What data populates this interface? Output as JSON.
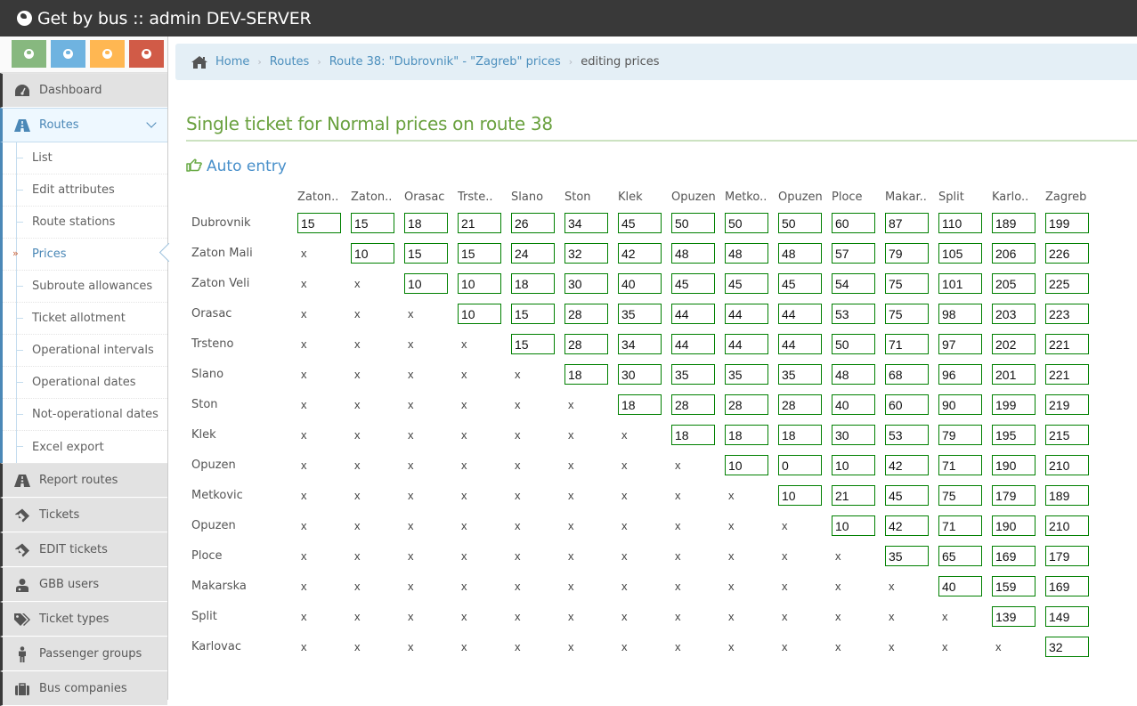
{
  "navbar": {
    "title": "Get by bus :: admin DEV-SERVER"
  },
  "sidebar": {
    "shortcuts": [
      {
        "color": "#87b87f",
        "icon": "globe-icon"
      },
      {
        "color": "#6fb3e0",
        "icon": "globe-icon"
      },
      {
        "color": "#ffb752",
        "icon": "globe-icon"
      },
      {
        "color": "#d15b47",
        "icon": "globe-icon"
      }
    ],
    "items": [
      {
        "label": "Dashboard",
        "icon": "dashboard-icon"
      },
      {
        "label": "Routes",
        "icon": "road-icon",
        "open": true,
        "subitems": [
          {
            "label": "List"
          },
          {
            "label": "Edit attributes"
          },
          {
            "label": "Route stations"
          },
          {
            "label": "Prices",
            "active": true
          },
          {
            "label": "Subroute allowances"
          },
          {
            "label": "Ticket allotment"
          },
          {
            "label": "Operational intervals"
          },
          {
            "label": "Operational dates"
          },
          {
            "label": "Not-operational dates"
          },
          {
            "label": "Excel export"
          }
        ]
      },
      {
        "label": "Report routes",
        "icon": "road-icon"
      },
      {
        "label": "Tickets",
        "icon": "ticket-icon"
      },
      {
        "label": "EDIT tickets",
        "icon": "ticket-icon"
      },
      {
        "label": "GBB users",
        "icon": "user-md-icon"
      },
      {
        "label": "Ticket types",
        "icon": "tags-icon"
      },
      {
        "label": "Passenger groups",
        "icon": "male-icon"
      },
      {
        "label": "Bus companies",
        "icon": "briefcase-icon"
      }
    ]
  },
  "breadcrumbs": {
    "home": "Home",
    "routes": "Routes",
    "route": "Route 38: \"Dubrovnik\" - \"Zagreb\" prices",
    "current": "editing prices"
  },
  "page": {
    "title": "Single ticket for Normal prices on route 38",
    "auto_entry": "Auto entry"
  },
  "colors": {
    "title_green": "#6aa13f",
    "link_blue": "#4c8fbd",
    "input_border": "#008000"
  },
  "table": {
    "columns": [
      "Zaton..",
      "Zaton..",
      "Orasac",
      "Trste..",
      "Slano",
      "Ston",
      "Klek",
      "Opuzen",
      "Metko..",
      "Opuzen",
      "Ploce",
      "Makar..",
      "Split",
      "Karlo..",
      "Zagreb"
    ],
    "rows": [
      {
        "label": "Dubrovnik",
        "values": [
          "15",
          "15",
          "18",
          "21",
          "26",
          "34",
          "45",
          "50",
          "50",
          "50",
          "60",
          "87",
          "110",
          "189",
          "199"
        ]
      },
      {
        "label": "Zaton Mali",
        "values": [
          "x",
          "10",
          "15",
          "15",
          "24",
          "32",
          "42",
          "48",
          "48",
          "48",
          "57",
          "79",
          "105",
          "206",
          "226"
        ]
      },
      {
        "label": "Zaton Veli",
        "values": [
          "x",
          "x",
          "10",
          "10",
          "18",
          "30",
          "40",
          "45",
          "45",
          "45",
          "54",
          "75",
          "101",
          "205",
          "225"
        ]
      },
      {
        "label": "Orasac",
        "values": [
          "x",
          "x",
          "x",
          "10",
          "15",
          "28",
          "35",
          "44",
          "44",
          "44",
          "53",
          "75",
          "98",
          "203",
          "223"
        ]
      },
      {
        "label": "Trsteno",
        "values": [
          "x",
          "x",
          "x",
          "x",
          "15",
          "28",
          "34",
          "44",
          "44",
          "44",
          "50",
          "71",
          "97",
          "202",
          "221"
        ]
      },
      {
        "label": "Slano",
        "values": [
          "x",
          "x",
          "x",
          "x",
          "x",
          "18",
          "30",
          "35",
          "35",
          "35",
          "48",
          "68",
          "96",
          "201",
          "221"
        ]
      },
      {
        "label": "Ston",
        "values": [
          "x",
          "x",
          "x",
          "x",
          "x",
          "x",
          "18",
          "28",
          "28",
          "28",
          "40",
          "60",
          "90",
          "199",
          "219"
        ]
      },
      {
        "label": "Klek",
        "values": [
          "x",
          "x",
          "x",
          "x",
          "x",
          "x",
          "x",
          "18",
          "18",
          "18",
          "30",
          "53",
          "79",
          "195",
          "215"
        ]
      },
      {
        "label": "Opuzen",
        "values": [
          "x",
          "x",
          "x",
          "x",
          "x",
          "x",
          "x",
          "x",
          "10",
          "0",
          "10",
          "42",
          "71",
          "190",
          "210"
        ]
      },
      {
        "label": "Metkovic",
        "values": [
          "x",
          "x",
          "x",
          "x",
          "x",
          "x",
          "x",
          "x",
          "x",
          "10",
          "21",
          "45",
          "75",
          "179",
          "189"
        ]
      },
      {
        "label": "Opuzen",
        "values": [
          "x",
          "x",
          "x",
          "x",
          "x",
          "x",
          "x",
          "x",
          "x",
          "x",
          "10",
          "42",
          "71",
          "190",
          "210"
        ]
      },
      {
        "label": "Ploce",
        "values": [
          "x",
          "x",
          "x",
          "x",
          "x",
          "x",
          "x",
          "x",
          "x",
          "x",
          "x",
          "35",
          "65",
          "169",
          "179"
        ]
      },
      {
        "label": "Makarska",
        "values": [
          "x",
          "x",
          "x",
          "x",
          "x",
          "x",
          "x",
          "x",
          "x",
          "x",
          "x",
          "x",
          "40",
          "159",
          "169"
        ]
      },
      {
        "label": "Split",
        "values": [
          "x",
          "x",
          "x",
          "x",
          "x",
          "x",
          "x",
          "x",
          "x",
          "x",
          "x",
          "x",
          "x",
          "139",
          "149"
        ]
      },
      {
        "label": "Karlovac",
        "values": [
          "x",
          "x",
          "x",
          "x",
          "x",
          "x",
          "x",
          "x",
          "x",
          "x",
          "x",
          "x",
          "x",
          "x",
          "32"
        ]
      }
    ]
  }
}
